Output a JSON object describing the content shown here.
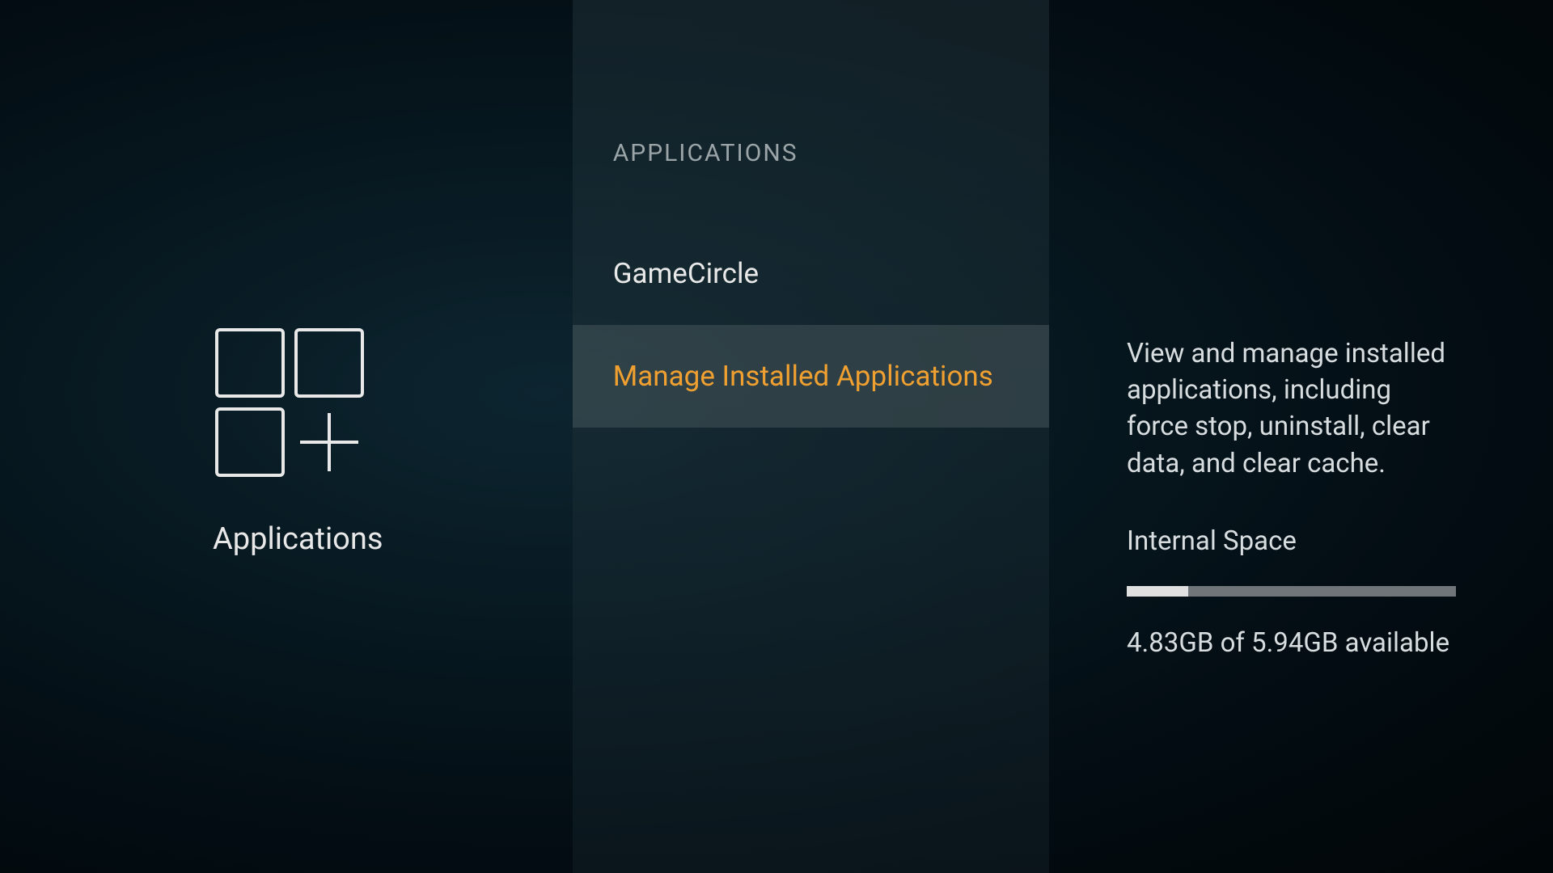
{
  "left": {
    "title": "Applications",
    "icon_name": "apps-grid-icon"
  },
  "middle": {
    "section_header": "APPLICATIONS",
    "items": [
      {
        "label": "GameCircle",
        "selected": false
      },
      {
        "label": "Manage Installed Applications",
        "selected": true
      }
    ]
  },
  "right": {
    "description": "View and manage installed applications, including force stop, uninstall, clear data, and clear cache.",
    "storage": {
      "label": "Internal Space",
      "available_gb": 4.83,
      "total_gb": 5.94,
      "text": "4.83GB of 5.94GB available",
      "used_percent": 18.7
    }
  }
}
